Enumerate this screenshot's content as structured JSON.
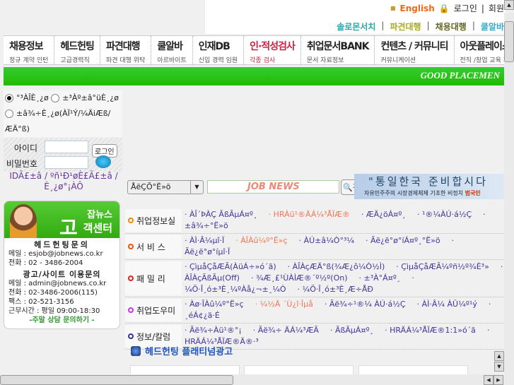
{
  "header": {
    "english": "English",
    "login": "로그인",
    "join": "회원",
    "sublinks": [
      "솔로몬서치",
      "파견대행",
      "채용대행",
      "쿨알바"
    ]
  },
  "nav": [
    {
      "m": "채용정보",
      "s": "정규 계약 인턴"
    },
    {
      "m": "헤드헌팅",
      "s": "고급경력직"
    },
    {
      "m": "파견대행",
      "s": "파견 대행 위탁"
    },
    {
      "m": "쿨알바",
      "s": "아르바이트"
    },
    {
      "m": "인재DB",
      "s": "신입 경력 임원"
    },
    {
      "m": "인·적성검사",
      "s": "각종 검사",
      "active": true
    },
    {
      "m": "취업문서BANK",
      "s": "문서 자료정보"
    },
    {
      "m": "컨텐츠 / 커뮤니티",
      "s": "커뮤니케이션"
    },
    {
      "m": "아웃플레이스먼",
      "s": "전직 /창업 교육 지원"
    }
  ],
  "slogan": "GOOD PLACEMEN",
  "radios": [
    "°³ÀÎÈ¸¿ø",
    "±³Àº±â°üÈ¸¿ø",
    "±â¾÷È¸¿ø(ÀÏ¹Ý/¼ÄiÆß/ÆÄ°ß)"
  ],
  "login": {
    "id_label": "아이디",
    "pw_label": "비밀번호",
    "button": "로그인",
    "links": [
      "IDÃ£±â",
      "ºñ¹Ð¹øÈ£Ã£±â",
      "È¸¿ø°¡ÀÔ"
    ]
  },
  "cc": {
    "brand": "잡뉴스",
    "title": "객센터",
    "go": "고",
    "h1": "헤드헌팅문의",
    "mail1": "메일 : esjob@jobnews.co.kr",
    "tel1": "전화 : 02 - 3486-2004",
    "h2": "광고/사이트 이용문의",
    "mail2": "메일 : admin@jobnews.co.kr",
    "tel2": "전화 : 02-3486-2006(115)",
    "fax": "팩스 : 02-521-3156",
    "hours": "근무시간 : 평일 09:00-18:30",
    "weekend": "-주말 상담 문의하기 -"
  },
  "search": {
    "select": "ÅëÇÕ°Ë»ö",
    "logo": "JOB NEWS",
    "button": "검색"
  },
  "banner": {
    "line1": "\"통일한국 준비합시다",
    "line2": "자유민주주의 시장경제체제 기초한 비정치",
    "line2b": "범국민"
  },
  "rows": [
    {
      "cat": "취업정보실",
      "color": "#e80",
      "links": [
        {
          "t": "ÀÎ´ÞÀÇ ÃßÃµÁ¤º¸"
        },
        {
          "t": "HRÀü¹®ÄÁ¼³ÅÏÆ®",
          "hl": true
        },
        {
          "t": "ÆÄ¿öÁ¤º¸"
        },
        {
          "t": "¹®¼ÀÚ·á½Ç"
        },
        {
          "t": "±â¾÷°Ë»ö"
        }
      ]
    },
    {
      "cat": "서 비 스",
      "color": "#e50",
      "links": [
        {
          "t": "ÀÌ·Â¼­µî·Ï"
        },
        {
          "t": "ÀÎÀû¼º°Ë»ç",
          "hl": true
        },
        {
          "t": "ÀÚ±â¼Ò°³¼­"
        },
        {
          "t": "Ãë¿ë°ø°íÁ¤º¸°Ë»ö"
        },
        {
          "t": "Ãë¿ë°ø°íµî·Ï"
        }
      ]
    },
    {
      "cat": "패 밀 리",
      "color": "#d22",
      "links": [
        {
          "t": "ÇìµåÇåÆÃ(ÀüÁ÷»ó´ã)"
        },
        {
          "t": "ÀÎÀçÆÄ°ß(¾Æ¿ô¼Ò½Ì)"
        },
        {
          "t": "ÇìµåÇåÆÃ¼ºñ½º¾È³»"
        },
        {
          "t": "ÀÎÀçÃßÃµ(Off)"
        },
        {
          "t": "¾Æ¸£¹ÙÀÌÆ®´º½º(On)"
        },
        {
          "t": "±³À°Á¤º¸"
        },
        {
          "t": "¼Ö·Î¸ó±³È¸¼ºÀå¿¬±¸¼Ò"
        },
        {
          "t": "¼Ö·Î¸ó±³È¸Æ÷ÅÐ"
        }
      ]
    },
    {
      "cat": "취업도우미",
      "color": "#c3e",
      "links": [
        {
          "t": "Àø·ÎÀû¼º°Ë»ç"
        },
        {
          "t": "¼½Ä ´Ù¿î·Îµå",
          "hl": true
        },
        {
          "t": "Ãë¾÷¹®¼ ÀÚ·á½Ç"
        },
        {
          "t": "ÀÌ·Â¼ ÀÛ¼º¹ý"
        },
        {
          "t": "¸éÁ¢¿ä·É"
        }
      ]
    },
    {
      "cat": "정보/칼럼",
      "color": "#339",
      "links": [
        {
          "t": "Ãë¾÷Àü¹®°¡"
        },
        {
          "t": "Ãë¾÷ ÄÁ¼³ÆÃ"
        },
        {
          "t": "ÃßÃµÁ¤º¸"
        },
        {
          "t": "HRÄÁ¼³ÅÏÆ®1:1»ó´ã"
        },
        {
          "t": "HRÄÁ¼³ÅÏÆ®Ä®·³"
        }
      ]
    }
  ],
  "section": "헤드헌팅 플래티넘광고"
}
